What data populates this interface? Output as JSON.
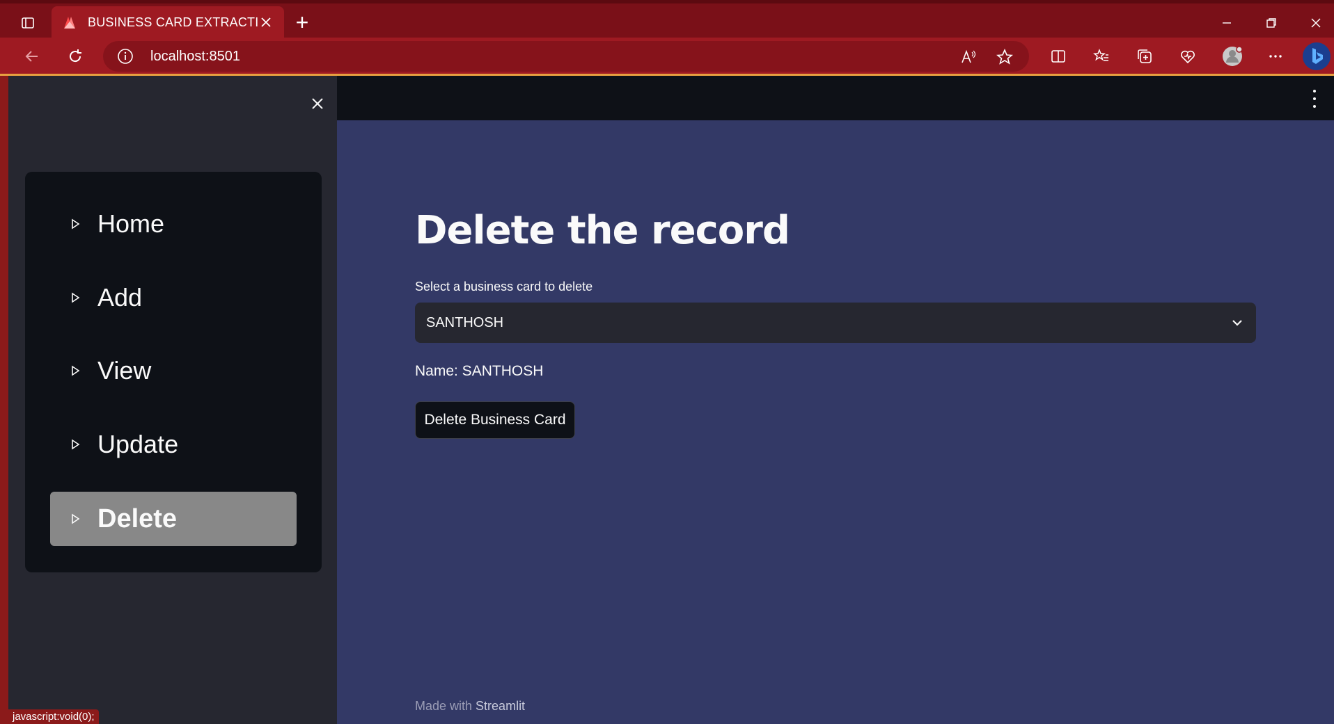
{
  "browser": {
    "tab_title": "BUSINESS CARD EXTRACTION",
    "url": "localhost:8501",
    "status_text": "javascript:void(0);"
  },
  "sidebar": {
    "items": [
      {
        "label": "Home",
        "active": false
      },
      {
        "label": "Add",
        "active": false
      },
      {
        "label": "View",
        "active": false
      },
      {
        "label": "Update",
        "active": false
      },
      {
        "label": "Delete",
        "active": true
      }
    ]
  },
  "main": {
    "title": "Delete the record",
    "select_label": "Select a business card to delete",
    "select_value": "SANTHOSH",
    "name_line": "Name: SANTHOSH",
    "delete_button": "Delete Business Card",
    "footer_prefix": "Made with ",
    "footer_brand": "Streamlit"
  },
  "colors": {
    "app_bg": "#333966",
    "sidebar_bg": "#262730",
    "menu_bg": "#0e1117",
    "active_item": "#888888",
    "browser_frame": "#9e1a22"
  }
}
